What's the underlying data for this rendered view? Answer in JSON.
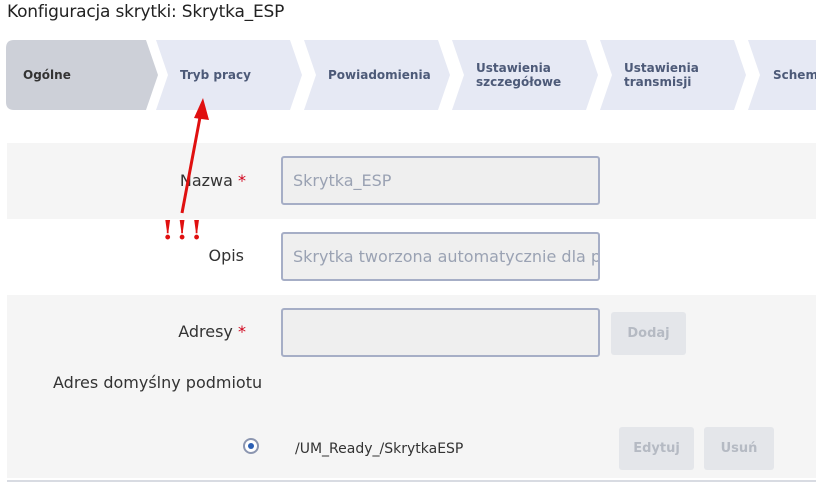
{
  "page": {
    "title": "Konfiguracja skrytki: Skrytka_ESP"
  },
  "wizard": {
    "steps": [
      {
        "label": "Ogólne",
        "active": true
      },
      {
        "label": "Tryb pracy",
        "active": false
      },
      {
        "label": "Powiadomienia",
        "active": false
      },
      {
        "label": "Ustawienia\nszczegółowe",
        "active": false
      },
      {
        "label": "Ustawienia\ntransmisji",
        "active": false
      },
      {
        "label": "Schema",
        "active": false
      }
    ]
  },
  "form": {
    "name": {
      "label": "Nazwa",
      "required_mark": "*",
      "value": "Skrytka_ESP"
    },
    "description": {
      "label": "Opis",
      "value": "Skrytka tworzona automatycznie dla podn"
    },
    "addresses": {
      "label": "Adresy",
      "required_mark": "*",
      "value": "",
      "add_button": "Dodaj"
    },
    "default_address": {
      "label": "Adres domyślny podmiotu",
      "value": "/UM_Ready_/SkrytkaESP",
      "edit_button": "Edytuj",
      "delete_button": "Usuń"
    }
  },
  "annotation": {
    "text": "!!!",
    "color": "#e01010"
  },
  "colors": {
    "step_active": "#cdd0d8",
    "step_inactive": "#e6e9f4",
    "accent": "#2b5fb4",
    "required": "#d0021b"
  }
}
